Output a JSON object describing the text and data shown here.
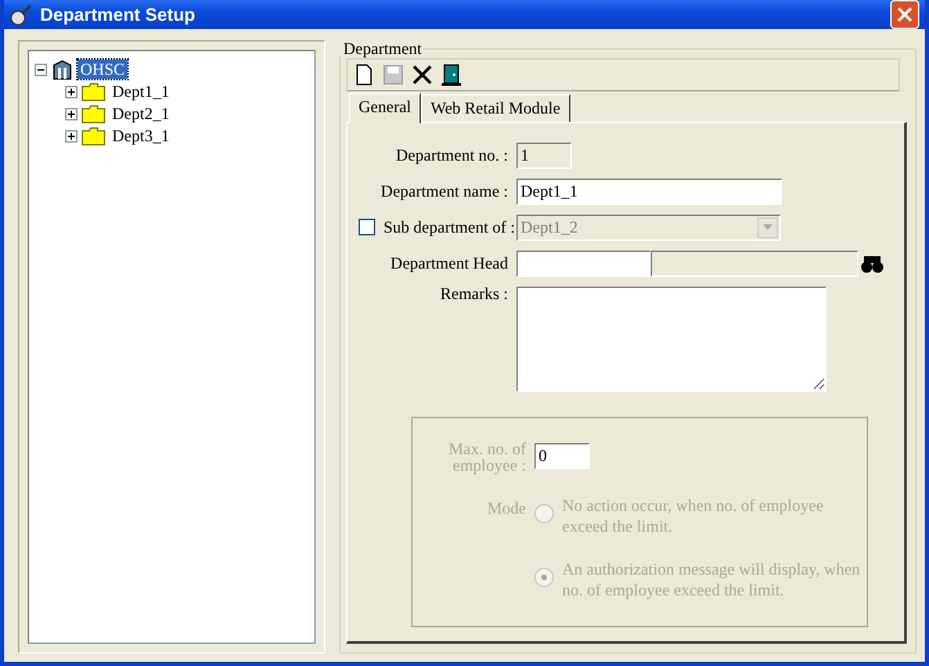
{
  "window": {
    "title": "Department Setup"
  },
  "tree": [
    {
      "label": "OHSC",
      "kind": "building",
      "selected": true,
      "expanded": true,
      "children": [
        {
          "label": "Dept1_1",
          "kind": "folder",
          "selected": false,
          "expanded": false
        },
        {
          "label": "Dept2_1",
          "kind": "folder",
          "selected": false,
          "expanded": false
        },
        {
          "label": "Dept3_1",
          "kind": "folder",
          "selected": false,
          "expanded": false
        }
      ]
    }
  ],
  "group": {
    "title": "Department"
  },
  "toolbar": [
    {
      "kind": "new",
      "disabled": false
    },
    {
      "kind": "save",
      "disabled": true
    },
    {
      "kind": "delete",
      "disabled": false
    },
    {
      "kind": "exit",
      "disabled": false
    }
  ],
  "tabs": [
    {
      "label": "General",
      "selected": true
    },
    {
      "label": "Web Retail Module",
      "selected": false
    }
  ],
  "form": {
    "department_no": {
      "label": "Department no. :",
      "value": "1",
      "disabled": true
    },
    "department_name": {
      "label": "Department name :",
      "value": "Dept1_1",
      "disabled": false
    },
    "sub_department": {
      "label": "Sub department of :",
      "checked": false,
      "value": "Dept1_2",
      "disabled": true
    },
    "department_head": {
      "label": "Department Head"
    },
    "remarks": {
      "label": "Remarks :"
    }
  },
  "limit": {
    "disabled": true,
    "max_label": "Max. no. of employee :",
    "max_value": "0",
    "mode_label": "Mode",
    "options": [
      {
        "label": "No action occur, when no. of employee exceed the limit.",
        "selected": false
      },
      {
        "label": "An authorization message will display, when no. of employee exceed the limit.",
        "selected": true
      }
    ]
  }
}
